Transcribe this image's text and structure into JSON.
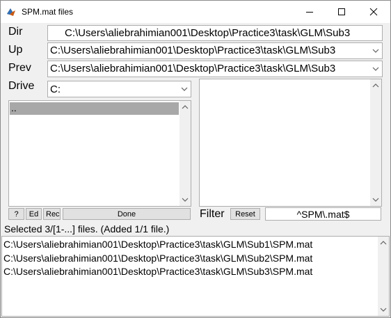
{
  "window": {
    "title": "SPM.mat files",
    "controls": {
      "minimize": "minimize-icon",
      "maximize": "maximize-icon",
      "close": "close-icon"
    }
  },
  "dir": {
    "label": "Dir",
    "value": "C:\\Users\\aliebrahimian001\\Desktop\\Practice3\\task\\GLM\\Sub3"
  },
  "up": {
    "label": "Up",
    "value": "C:\\Users\\aliebrahimian001\\Desktop\\Practice3\\task\\GLM\\Sub3"
  },
  "prev": {
    "label": "Prev",
    "value": "C:\\Users\\aliebrahimian001\\Desktop\\Practice3\\task\\GLM\\Sub3"
  },
  "drive": {
    "label": "Drive",
    "value": "C:"
  },
  "dir_list": {
    "items": [
      ".."
    ]
  },
  "buttons": {
    "help": "?",
    "edit": "Ed",
    "rec": "Rec",
    "done": "Done",
    "reset": "Reset"
  },
  "filter": {
    "label": "Filter",
    "value": "^SPM\\.mat$"
  },
  "status": "Selected 3/[1-...] files. (Added 1/1 file.)",
  "selected_files": [
    "C:\\Users\\aliebrahimian001\\Desktop\\Practice3\\task\\GLM\\Sub1\\SPM.mat",
    "C:\\Users\\aliebrahimian001\\Desktop\\Practice3\\task\\GLM\\Sub2\\SPM.mat",
    "C:\\Users\\aliebrahimian001\\Desktop\\Practice3\\task\\GLM\\Sub3\\SPM.mat"
  ],
  "colors": {
    "selection": "#a8a8a8",
    "background": "#f0f0f0",
    "button": "#e1e1e1"
  }
}
